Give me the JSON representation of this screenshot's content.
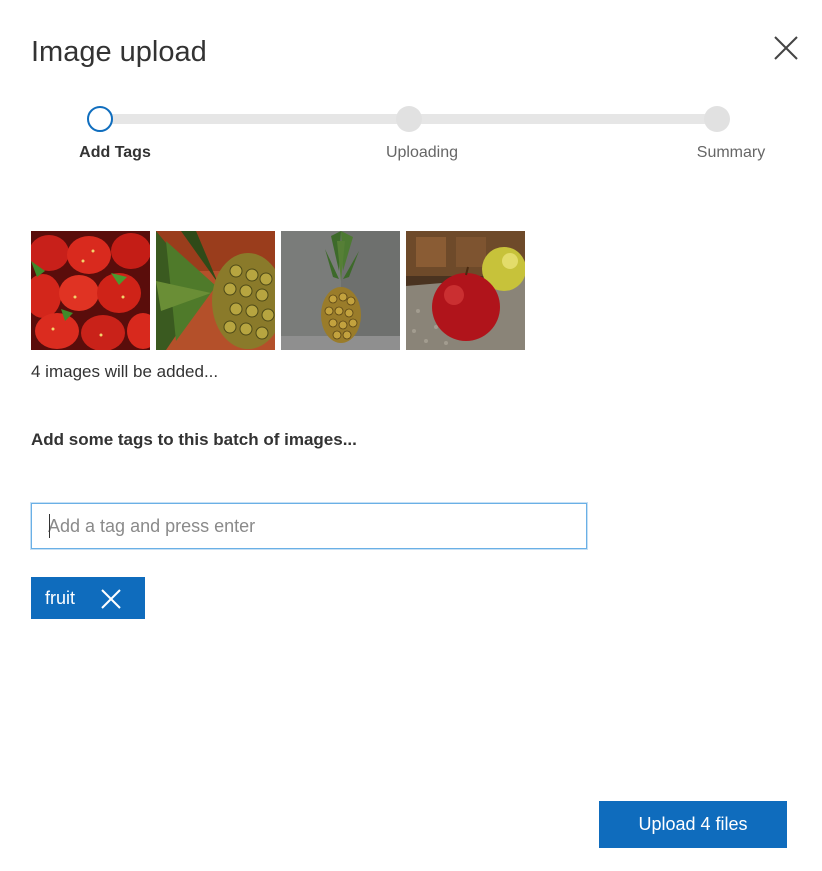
{
  "dialog": {
    "title": "Image upload",
    "close_icon": "close-icon"
  },
  "stepper": {
    "steps": [
      {
        "label": "Add Tags",
        "state": "current"
      },
      {
        "label": "Uploading",
        "state": "pending"
      },
      {
        "label": "Summary",
        "state": "pending"
      }
    ]
  },
  "images": {
    "thumbnails": [
      {
        "subject": "strawberries"
      },
      {
        "subject": "pineapple-closeup"
      },
      {
        "subject": "pineapple"
      },
      {
        "subject": "apples"
      }
    ],
    "count_text": "4 images will be added..."
  },
  "tags": {
    "heading": "Add some tags to this batch of images...",
    "input_placeholder": "Add a tag and press enter",
    "input_value": "",
    "chips": [
      {
        "label": "fruit",
        "remove_icon": "close-icon"
      }
    ]
  },
  "footer": {
    "upload_label": "Upload 4 files"
  },
  "colors": {
    "accent": "#0f6cbd",
    "active_step_ring": "#106ebe",
    "pending_step": "#e1e1e1",
    "track": "#e6e6e6"
  }
}
